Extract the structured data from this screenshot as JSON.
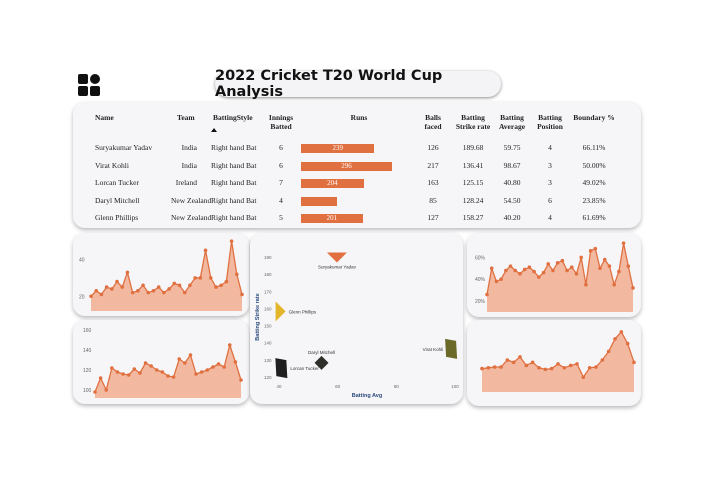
{
  "title": "2022 Cricket T20 World Cup Analysis",
  "logo_icon": "grid-logo-icon",
  "table": {
    "headers": {
      "name": "Name",
      "team": "Team",
      "batting_style": "BattingStyle",
      "innings_1": "Innings",
      "innings_2": "Batted",
      "runs": "Runs",
      "balls_1": "Balls",
      "balls_2": "faced",
      "sr_1": "Batting",
      "sr_2": "Strike rate",
      "avg_1": "Batting",
      "avg_2": "Average",
      "pos_1": "Batting",
      "pos_2": "Position",
      "boundary": "Boundary %"
    },
    "sort_icon": "sort-ascending-icon",
    "bar_color": "#e07040",
    "max_runs": 296,
    "rows": [
      {
        "name": "Suryakumar Yadav",
        "team": "India",
        "style": "Right hand Bat",
        "innings": "6",
        "runs": 239,
        "runs_label": "239",
        "balls": "126",
        "sr": "189.68",
        "avg": "59.75",
        "pos": "4",
        "boundary": "66.11%"
      },
      {
        "name": "Virat Kohli",
        "team": "India",
        "style": "Right hand Bat",
        "innings": "6",
        "runs": 296,
        "runs_label": "296",
        "balls": "217",
        "sr": "136.41",
        "avg": "98.67",
        "pos": "3",
        "boundary": "50.00%"
      },
      {
        "name": "Lorcan Tucker",
        "team": "Ireland",
        "style": "Right hand Bat",
        "innings": "7",
        "runs": 204,
        "runs_label": "204",
        "balls": "163",
        "sr": "125.15",
        "avg": "40.80",
        "pos": "3",
        "boundary": "49.02%"
      },
      {
        "name": "Daryl Mitchell",
        "team": "New Zealand",
        "style": "Right hand Bat",
        "innings": "4",
        "runs": 117,
        "runs_label": "",
        "balls": "85",
        "sr": "128.24",
        "avg": "54.50",
        "pos": "6",
        "boundary": "23.85%"
      },
      {
        "name": "Glenn Phillips",
        "team": "New Zealand",
        "style": "Right hand Bat",
        "innings": "5",
        "runs": 201,
        "runs_label": "201",
        "balls": "127",
        "sr": "158.27",
        "avg": "40.20",
        "pos": "4",
        "boundary": "61.69%"
      }
    ]
  },
  "colors": {
    "accent": "#e07040",
    "area_fill": "#f2b9a0",
    "card_bg": "#f6f6f9"
  },
  "chart_data": [
    {
      "type": "area",
      "ylabels": [
        "40",
        "20"
      ],
      "ylim": [
        12,
        49
      ],
      "values": [
        20,
        23,
        21,
        25,
        24,
        28,
        25,
        33,
        22,
        23,
        26,
        22,
        23,
        25,
        22,
        24,
        27,
        26,
        22,
        26,
        30,
        30,
        45,
        30,
        25,
        26,
        28,
        50,
        32,
        21
      ]
    },
    {
      "type": "area",
      "ylabels": [
        "160",
        "140",
        "120",
        "100"
      ],
      "ylim": [
        92,
        162
      ],
      "values": [
        98,
        112,
        100,
        122,
        118,
        116,
        115,
        121,
        117,
        127,
        124,
        120,
        118,
        114,
        113,
        131,
        127,
        135,
        116,
        118,
        120,
        123,
        126,
        123,
        145,
        128,
        110
      ]
    },
    {
      "type": "scatter",
      "xlabel": "Batting Avg",
      "ylabel": "Batting Strike rate",
      "xticks": [
        "40",
        "60",
        "80",
        "100"
      ],
      "yticks": [
        "190",
        "180",
        "170",
        "160",
        "150",
        "140",
        "130",
        "120"
      ],
      "xlim": [
        40,
        100
      ],
      "ylim": [
        120,
        190
      ],
      "points": [
        {
          "label": "Suryakumar Yadav",
          "x": 59.75,
          "y": 189.68,
          "color": "#e07040",
          "shape": "triangle-down"
        },
        {
          "label": "Glenn Phillips",
          "x": 40.2,
          "y": 158.27,
          "color": "#e3b62a",
          "shape": "triangle-right"
        },
        {
          "label": "Virat Kohli",
          "x": 98.67,
          "y": 136.41,
          "color": "#6b6a28",
          "shape": "square"
        },
        {
          "label": "Daryl Mitchell",
          "x": 54.5,
          "y": 128.24,
          "color": "#2f2f2a",
          "shape": "diamond"
        },
        {
          "label": "Lorcan Tucker",
          "x": 40.8,
          "y": 125.15,
          "color": "#1f1f1f",
          "shape": "square"
        }
      ]
    },
    {
      "type": "area",
      "ylabels": [
        "60%",
        "40%",
        "20%"
      ],
      "ylim": [
        10,
        75
      ],
      "values": [
        26,
        50,
        38,
        40,
        48,
        52,
        48,
        45,
        49,
        51,
        47,
        42,
        46,
        54,
        48,
        55,
        57,
        48,
        51,
        45,
        60,
        35,
        66,
        68,
        50,
        58,
        52,
        35,
        47,
        73,
        52,
        32
      ]
    },
    {
      "type": "area",
      "ylabels": [],
      "ylim": [
        90,
        172
      ],
      "values": [
        120,
        121,
        122,
        122,
        131,
        128,
        135,
        124,
        128,
        121,
        119,
        120,
        126,
        121,
        124,
        126,
        109,
        121,
        122,
        131,
        142,
        158,
        167,
        152,
        128
      ]
    }
  ]
}
